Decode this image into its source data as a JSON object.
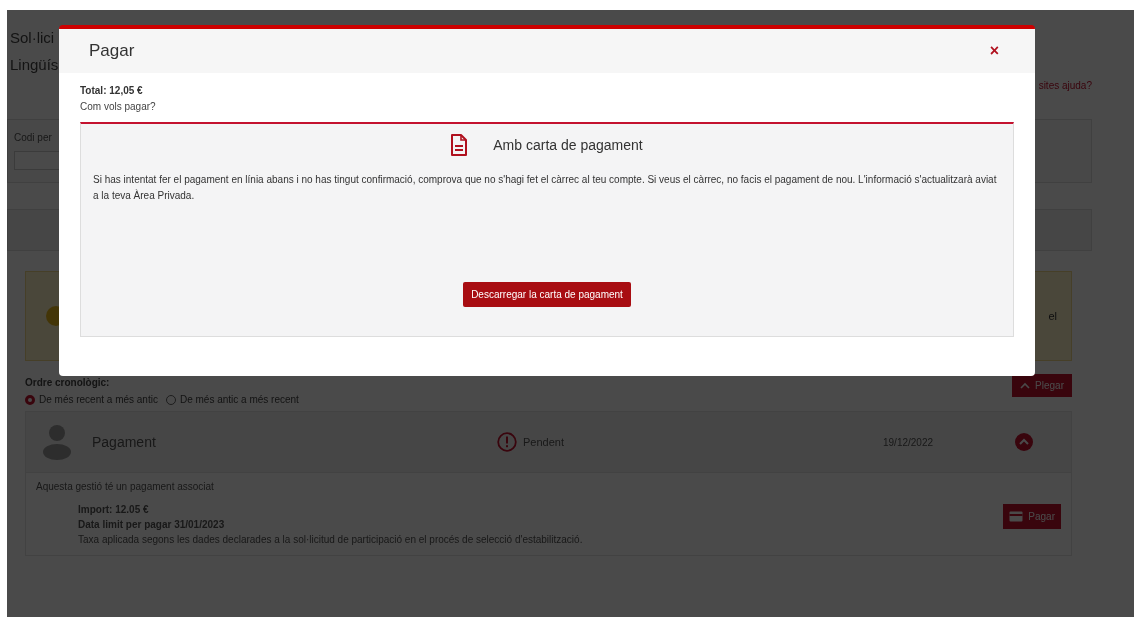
{
  "background_page": {
    "title_lines": [
      "Sol·lici",
      "Lingüís"
    ],
    "help_link": "sites ajuda?",
    "field_label": "Codi per",
    "notice_text": "el",
    "order": {
      "label": "Ordre cronològic:",
      "options": [
        {
          "label": "De més recent a més antic",
          "selected": true
        },
        {
          "label": "De més antic a més recent",
          "selected": false
        }
      ]
    },
    "collapse_button": "Plegar",
    "step": {
      "title": "Pagament",
      "status": "Pendent",
      "date": "19/12/2022",
      "expanded": true,
      "description": "Aquesta gestió té un pagament associat",
      "import": "Import: 12.05 €",
      "deadline": "Data limit per pagar 31/01/2023",
      "note": "Taxa aplicada segons les dades declarades a la sol·licitud de participació en el procés de selecció d'estabilització.",
      "pay_button": "Pagar"
    }
  },
  "modal": {
    "title": "Pagar",
    "close": "×",
    "total": "Total: 12,05 €",
    "question": "Com vols pagar?",
    "option": {
      "title": "Amb carta de pagament",
      "text": "Si has intentat fer el pagament en línia abans i no has tingut confirmació, comprova que no s'hagi fet el càrrec al teu compte. Si veus el càrrec, no facis el pagament de nou. L'informació s'actualitzarà aviat a la teva Àrea Privada.",
      "button": "Descarregar la carta de pagament"
    }
  }
}
